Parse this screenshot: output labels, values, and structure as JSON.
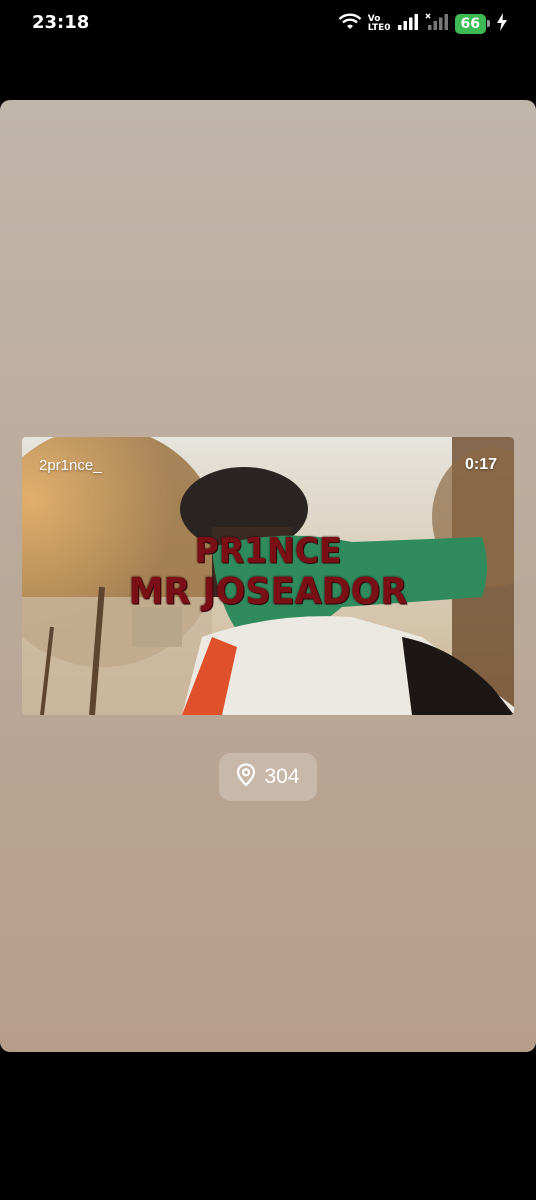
{
  "status_bar": {
    "time": "23:18",
    "network_label_top": "Vo",
    "network_label_bottom": "LTE0",
    "battery_level": "66"
  },
  "video": {
    "username": "2pr1nce_",
    "duration": "0:17",
    "title_line1": "PR1NCE",
    "title_line2": "MR JOSEADOR"
  },
  "location": {
    "icon": "map-pin-icon",
    "count": "304"
  },
  "colors": {
    "battery": "#3cba54",
    "title": "#7a0f16",
    "card_top": "#c1b6aa",
    "card_bottom": "#b89e8a"
  }
}
